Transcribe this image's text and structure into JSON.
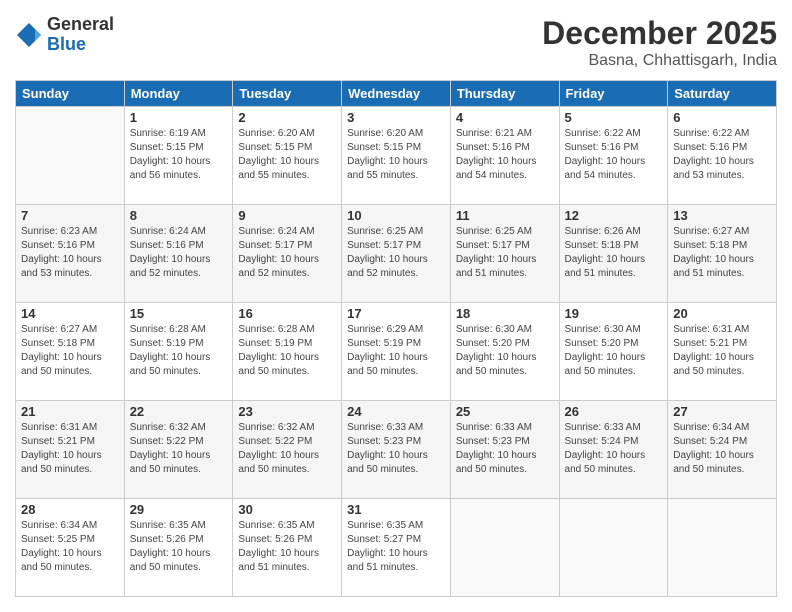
{
  "logo": {
    "general": "General",
    "blue": "Blue"
  },
  "title": "December 2025",
  "location": "Basna, Chhattisgarh, India",
  "headers": [
    "Sunday",
    "Monday",
    "Tuesday",
    "Wednesday",
    "Thursday",
    "Friday",
    "Saturday"
  ],
  "weeks": [
    [
      {
        "day": "",
        "info": ""
      },
      {
        "day": "1",
        "info": "Sunrise: 6:19 AM\nSunset: 5:15 PM\nDaylight: 10 hours\nand 56 minutes."
      },
      {
        "day": "2",
        "info": "Sunrise: 6:20 AM\nSunset: 5:15 PM\nDaylight: 10 hours\nand 55 minutes."
      },
      {
        "day": "3",
        "info": "Sunrise: 6:20 AM\nSunset: 5:15 PM\nDaylight: 10 hours\nand 55 minutes."
      },
      {
        "day": "4",
        "info": "Sunrise: 6:21 AM\nSunset: 5:16 PM\nDaylight: 10 hours\nand 54 minutes."
      },
      {
        "day": "5",
        "info": "Sunrise: 6:22 AM\nSunset: 5:16 PM\nDaylight: 10 hours\nand 54 minutes."
      },
      {
        "day": "6",
        "info": "Sunrise: 6:22 AM\nSunset: 5:16 PM\nDaylight: 10 hours\nand 53 minutes."
      }
    ],
    [
      {
        "day": "7",
        "info": "Sunrise: 6:23 AM\nSunset: 5:16 PM\nDaylight: 10 hours\nand 53 minutes."
      },
      {
        "day": "8",
        "info": "Sunrise: 6:24 AM\nSunset: 5:16 PM\nDaylight: 10 hours\nand 52 minutes."
      },
      {
        "day": "9",
        "info": "Sunrise: 6:24 AM\nSunset: 5:17 PM\nDaylight: 10 hours\nand 52 minutes."
      },
      {
        "day": "10",
        "info": "Sunrise: 6:25 AM\nSunset: 5:17 PM\nDaylight: 10 hours\nand 52 minutes."
      },
      {
        "day": "11",
        "info": "Sunrise: 6:25 AM\nSunset: 5:17 PM\nDaylight: 10 hours\nand 51 minutes."
      },
      {
        "day": "12",
        "info": "Sunrise: 6:26 AM\nSunset: 5:18 PM\nDaylight: 10 hours\nand 51 minutes."
      },
      {
        "day": "13",
        "info": "Sunrise: 6:27 AM\nSunset: 5:18 PM\nDaylight: 10 hours\nand 51 minutes."
      }
    ],
    [
      {
        "day": "14",
        "info": "Sunrise: 6:27 AM\nSunset: 5:18 PM\nDaylight: 10 hours\nand 50 minutes."
      },
      {
        "day": "15",
        "info": "Sunrise: 6:28 AM\nSunset: 5:19 PM\nDaylight: 10 hours\nand 50 minutes."
      },
      {
        "day": "16",
        "info": "Sunrise: 6:28 AM\nSunset: 5:19 PM\nDaylight: 10 hours\nand 50 minutes."
      },
      {
        "day": "17",
        "info": "Sunrise: 6:29 AM\nSunset: 5:19 PM\nDaylight: 10 hours\nand 50 minutes."
      },
      {
        "day": "18",
        "info": "Sunrise: 6:30 AM\nSunset: 5:20 PM\nDaylight: 10 hours\nand 50 minutes."
      },
      {
        "day": "19",
        "info": "Sunrise: 6:30 AM\nSunset: 5:20 PM\nDaylight: 10 hours\nand 50 minutes."
      },
      {
        "day": "20",
        "info": "Sunrise: 6:31 AM\nSunset: 5:21 PM\nDaylight: 10 hours\nand 50 minutes."
      }
    ],
    [
      {
        "day": "21",
        "info": "Sunrise: 6:31 AM\nSunset: 5:21 PM\nDaylight: 10 hours\nand 50 minutes."
      },
      {
        "day": "22",
        "info": "Sunrise: 6:32 AM\nSunset: 5:22 PM\nDaylight: 10 hours\nand 50 minutes."
      },
      {
        "day": "23",
        "info": "Sunrise: 6:32 AM\nSunset: 5:22 PM\nDaylight: 10 hours\nand 50 minutes."
      },
      {
        "day": "24",
        "info": "Sunrise: 6:33 AM\nSunset: 5:23 PM\nDaylight: 10 hours\nand 50 minutes."
      },
      {
        "day": "25",
        "info": "Sunrise: 6:33 AM\nSunset: 5:23 PM\nDaylight: 10 hours\nand 50 minutes."
      },
      {
        "day": "26",
        "info": "Sunrise: 6:33 AM\nSunset: 5:24 PM\nDaylight: 10 hours\nand 50 minutes."
      },
      {
        "day": "27",
        "info": "Sunrise: 6:34 AM\nSunset: 5:24 PM\nDaylight: 10 hours\nand 50 minutes."
      }
    ],
    [
      {
        "day": "28",
        "info": "Sunrise: 6:34 AM\nSunset: 5:25 PM\nDaylight: 10 hours\nand 50 minutes."
      },
      {
        "day": "29",
        "info": "Sunrise: 6:35 AM\nSunset: 5:26 PM\nDaylight: 10 hours\nand 50 minutes."
      },
      {
        "day": "30",
        "info": "Sunrise: 6:35 AM\nSunset: 5:26 PM\nDaylight: 10 hours\nand 51 minutes."
      },
      {
        "day": "31",
        "info": "Sunrise: 6:35 AM\nSunset: 5:27 PM\nDaylight: 10 hours\nand 51 minutes."
      },
      {
        "day": "",
        "info": ""
      },
      {
        "day": "",
        "info": ""
      },
      {
        "day": "",
        "info": ""
      }
    ]
  ]
}
